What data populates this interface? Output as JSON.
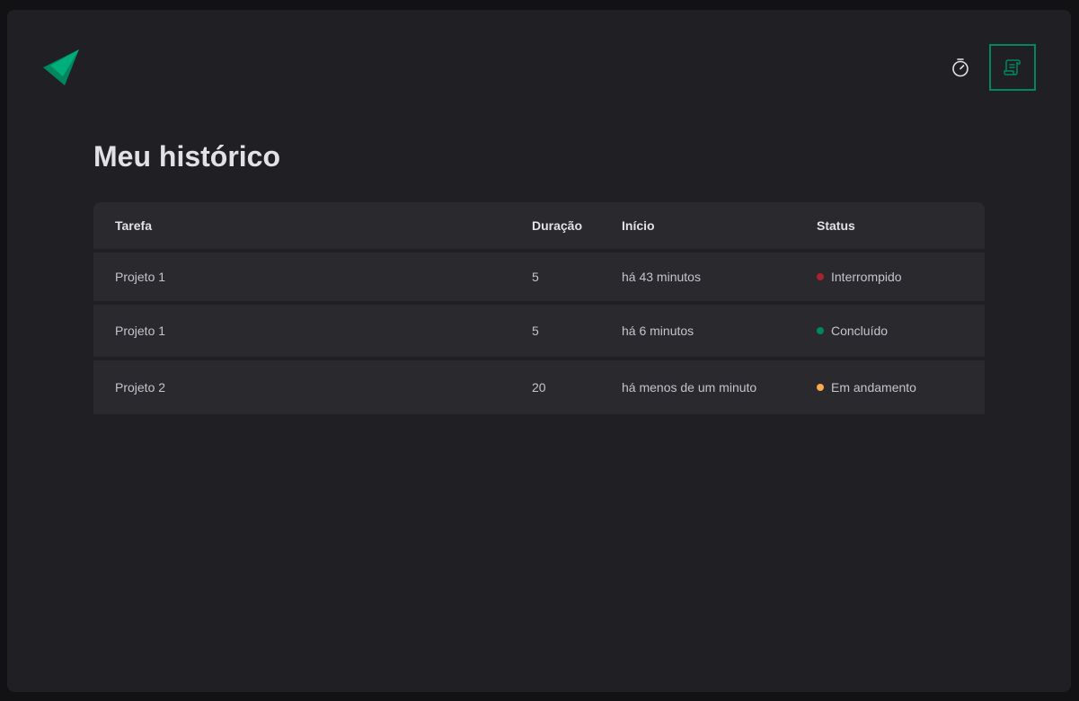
{
  "header": {
    "logo_icon": "play-triangles-logo",
    "nav": [
      {
        "icon": "timer-icon",
        "active": false
      },
      {
        "icon": "scroll-icon",
        "active": true
      }
    ]
  },
  "page": {
    "title": "Meu histórico"
  },
  "table": {
    "headers": {
      "task": "Tarefa",
      "duration": "Duração",
      "start": "Início",
      "status": "Status"
    },
    "rows": [
      {
        "task": "Projeto 1",
        "duration": "5",
        "start": "há 43 minutos",
        "status": "Interrompido",
        "status_color": "#ab222e"
      },
      {
        "task": "Projeto 1",
        "duration": "5",
        "start": "há 6 minutos",
        "status": "Concluído",
        "status_color": "#00875f"
      },
      {
        "task": "Projeto 2",
        "duration": "20",
        "start": "há menos de um minuto",
        "status": "Em andamento",
        "status_color": "#fba94c"
      }
    ]
  },
  "colors": {
    "accent": "#00875f",
    "background": "#202024",
    "surface": "#29292e"
  }
}
